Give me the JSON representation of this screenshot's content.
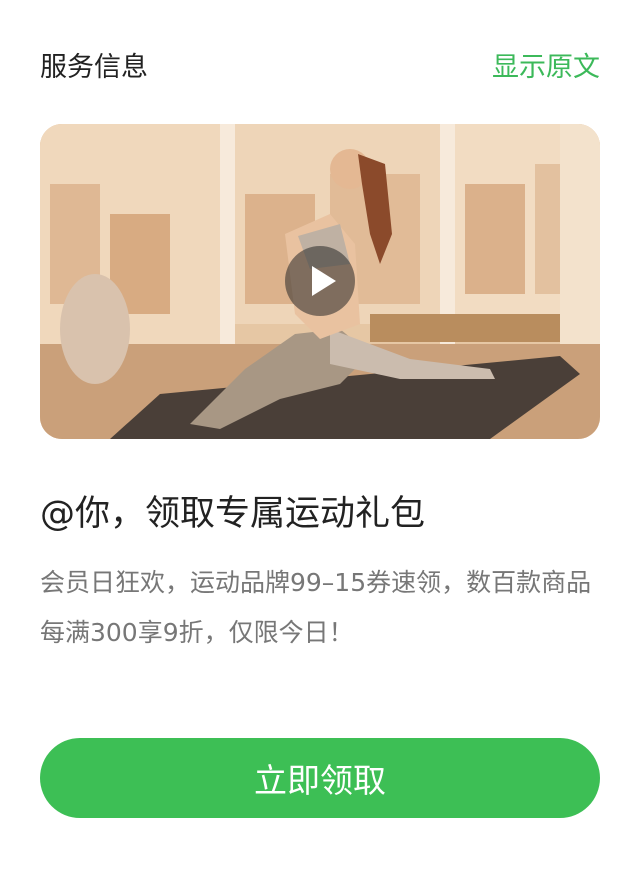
{
  "header": {
    "title": "服务信息",
    "show_original_label": "显示原文"
  },
  "media": {
    "play_icon": "play-icon"
  },
  "content": {
    "headline": "@你，领取专属运动礼包",
    "description": "会员日狂欢，运动品牌99–15券速领，数百款商品每满300享9折，仅限今日！"
  },
  "actions": {
    "claim_button_label": "立即领取"
  },
  "colors": {
    "accent": "#3cb95a",
    "button": "#3dbf55",
    "title_text": "#222222",
    "body_text": "#777777"
  }
}
